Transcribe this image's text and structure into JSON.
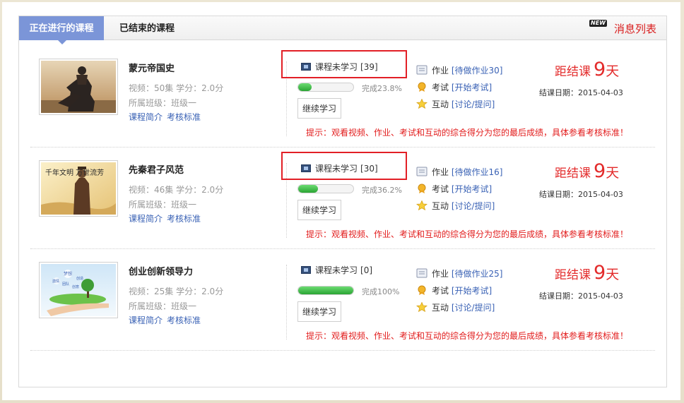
{
  "tabs": {
    "active": "正在进行的课程",
    "ended": "已结束的课程"
  },
  "messages": {
    "badge": "NEW",
    "label": "消息列表"
  },
  "colors": {
    "accent_tab": "#7b95d8",
    "due_red": "#e32b2b",
    "link_blue": "#3a62b5",
    "highlight_box": "#e21f26",
    "progress_green": "#2aa533"
  },
  "courses": [
    {
      "title": "蒙元帝国史",
      "video": "视频：50集",
      "credit": "学分：2.0分",
      "class_label": "所属班级：班级一",
      "intro_link": "课程简介",
      "assess_link": "考核标准",
      "study_label": "课程未学习",
      "study_count": "[39]",
      "progress": 0.238,
      "progress_text": "完成23.8%",
      "continue": "继续学习",
      "homework_label": "作业",
      "homework_link": "[待做作业30]",
      "exam_label": "考试",
      "exam_link": "[开始考试]",
      "interact_label": "互动",
      "interact_link": "[讨论/提问]",
      "due_label": "距结课",
      "due_num": "9",
      "due_unit": "天",
      "end_date": "结课日期：2015-04-03",
      "tip": "提示：观看视频、作业、考试和互动的综合得分为您的最后成绩，具体参看考核标准！",
      "highlighted": true
    },
    {
      "title": "先秦君子风范",
      "video": "视频：46集",
      "credit": "学分：2.0分",
      "class_label": "所属班级：班级一",
      "intro_link": "课程简介",
      "assess_link": "考核标准",
      "study_label": "课程未学习",
      "study_count": "[30]",
      "progress": 0.362,
      "progress_text": "完成36.2%",
      "continue": "继续学习",
      "homework_label": "作业",
      "homework_link": "[待做作业16]",
      "exam_label": "考试",
      "exam_link": "[开始考试]",
      "interact_label": "互动",
      "interact_link": "[讨论/提问]",
      "due_label": "距结课",
      "due_num": "9",
      "due_unit": "天",
      "end_date": "结课日期：2015-04-03",
      "tip": "提示：观看视频、作业、考试和互动的综合得分为您的最后成绩，具体参看考核标准！",
      "highlighted": true,
      "thumb_text": "千年文明 万世流芳"
    },
    {
      "title": "创业创新领导力",
      "video": "视频：25集",
      "credit": "学分：2.0分",
      "class_label": "所属班级：班级一",
      "intro_link": "课程简介",
      "assess_link": "考核标准",
      "study_label": "课程未学习",
      "study_count": "[0]",
      "progress": 1.0,
      "progress_text": "完成100%",
      "continue": "继续学习",
      "homework_label": "作业",
      "homework_link": "[待做作业25]",
      "exam_label": "考试",
      "exam_link": "[开始考试]",
      "interact_label": "互动",
      "interact_link": "[讨论/提问]",
      "due_label": "距结课",
      "due_num": "9",
      "due_unit": "天",
      "end_date": "结课日期：2015-04-03",
      "tip": "提示：观看视频、作业、考试和互动的综合得分为您的最后成绩，具体参看考核标准！",
      "highlighted": false,
      "thumb_words": [
        "梦想",
        "创造",
        "激情",
        "团队",
        "创意"
      ]
    }
  ]
}
